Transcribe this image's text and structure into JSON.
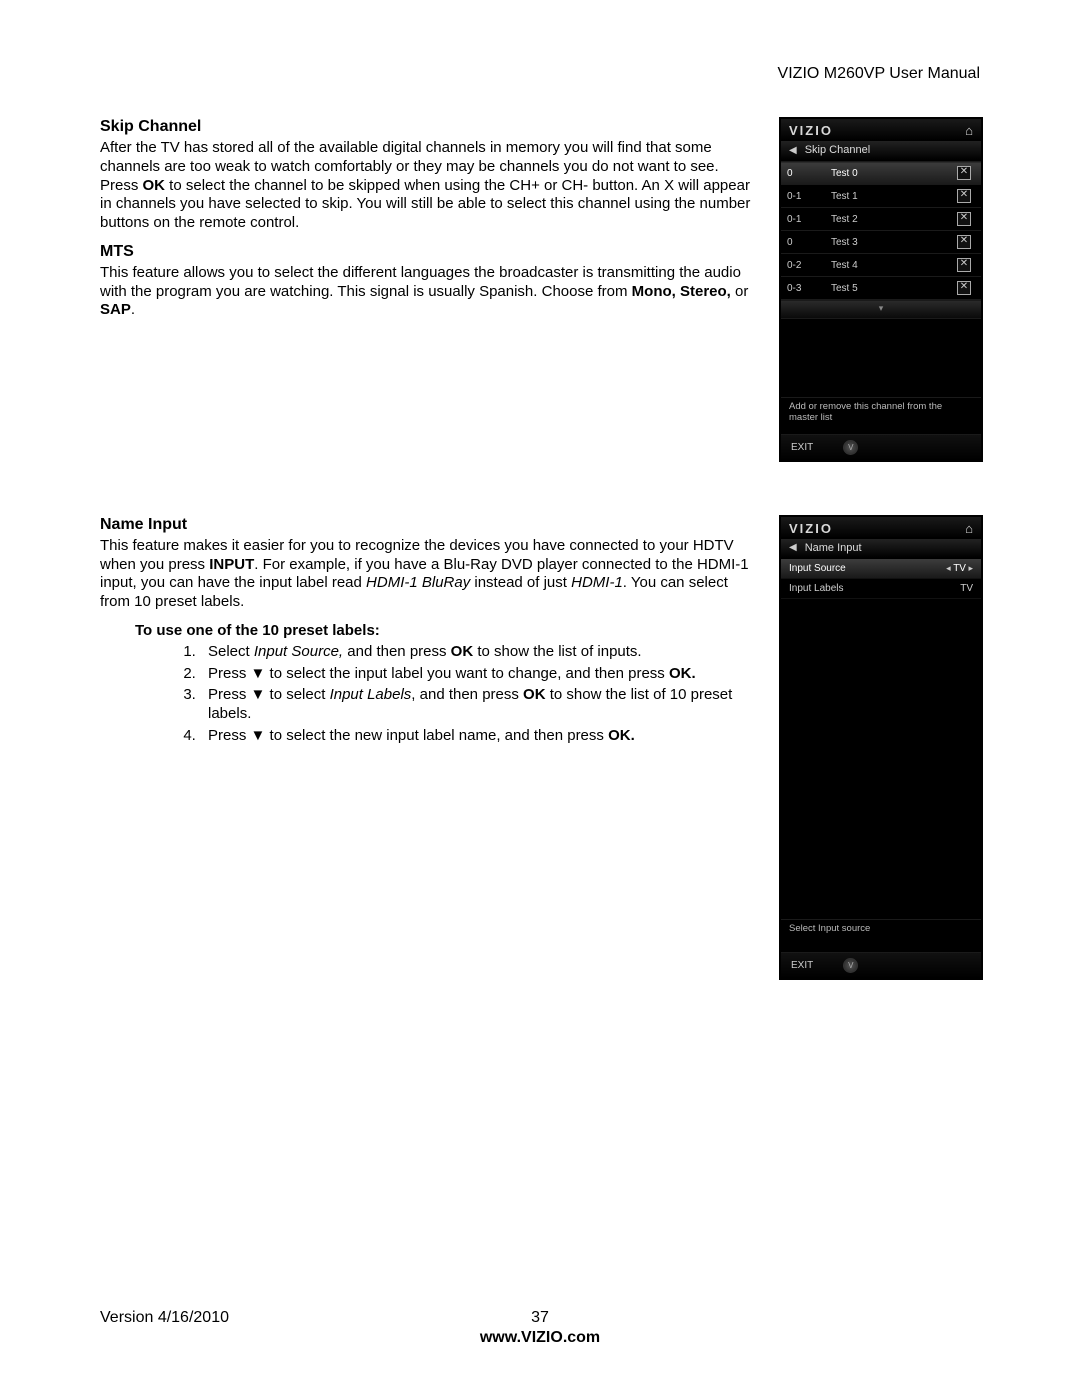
{
  "header": {
    "title": "VIZIO M260VP User Manual"
  },
  "section1": {
    "heading": "Skip Channel",
    "p1a": "After the TV has stored all of the available digital channels in memory you will find that some channels are too weak to watch comfortably or they may be channels you do not want to see. Press ",
    "p1_ok": "OK",
    "p1b": " to select the channel to be skipped when using the CH+ or CH- button. An X will appear in channels you have selected to skip. You will still be able to select this channel using the number buttons on the remote control."
  },
  "section2": {
    "heading": "MTS",
    "p1a": "This feature allows you to select the different languages the broadcaster is transmitting the audio with the program you are watching. This signal is usually Spanish. Choose from ",
    "p1_opts": "Mono, Stereo,",
    "p1_or": " or ",
    "p1_sap": "SAP",
    "p1_end": "."
  },
  "section3": {
    "heading": "Name Input",
    "p1a": "This feature makes it easier for you to recognize the devices you have connected to your HDTV when you press ",
    "p1_input": "INPUT",
    "p1b": ". For example, if you have a Blu-Ray DVD player connected to the HDMI-1 input, you can have the input label read ",
    "p1_i1": "HDMI-1 BluRay",
    "p1c": " instead of just ",
    "p1_i2": "HDMI-1",
    "p1d": ". You can select from 10 preset labels.",
    "preset_heading": "To use one of the 10 preset labels:",
    "steps": {
      "s1a": "Select ",
      "s1i": "Input Source,",
      "s1b": " and then press ",
      "s1ok": "OK",
      "s1c": " to show the list of inputs.",
      "s2a": "Press ▼ to select the input label you want to change, and then press ",
      "s2ok": "OK.",
      "s3a": "Press ▼ to select ",
      "s3i": "Input Labels",
      "s3b": ", and then press ",
      "s3ok": "OK",
      "s3c": " to show the list of 10 preset labels.",
      "s4a": "Press ▼ to select the new input label name, and then press ",
      "s4ok": "OK."
    }
  },
  "osd1": {
    "brand": "VIZIO",
    "home_glyph": "⌂",
    "back_glyph": "◀",
    "title": "Skip Channel",
    "channels": [
      {
        "num": "0",
        "name": "Test 0",
        "checked": true,
        "hl": true
      },
      {
        "num": "0-1",
        "name": "Test 1",
        "checked": true,
        "hl": false
      },
      {
        "num": "0-1",
        "name": "Test 2",
        "checked": true,
        "hl": false
      },
      {
        "num": "0",
        "name": "Test 3",
        "checked": true,
        "hl": false
      },
      {
        "num": "0-2",
        "name": "Test 4",
        "checked": true,
        "hl": false
      },
      {
        "num": "0-3",
        "name": "Test 5",
        "checked": true,
        "hl": false
      }
    ],
    "more_glyph": "▾",
    "hint": "Add or remove this channel from the master list",
    "exit": "EXIT",
    "vbtn_glyph": "V"
  },
  "osd2": {
    "brand": "VIZIO",
    "home_glyph": "⌂",
    "back_glyph": "◀",
    "title": "Name Input",
    "rows": [
      {
        "label": "Input Source",
        "value": "TV",
        "arrows": true,
        "hl": true
      },
      {
        "label": "Input Labels",
        "value": "TV",
        "arrows": false,
        "hl": false
      }
    ],
    "hint": "Select Input source",
    "exit": "EXIT",
    "vbtn_glyph": "V"
  },
  "footer": {
    "version": "Version 4/16/2010",
    "page": "37",
    "url": "www.VIZIO.com"
  }
}
